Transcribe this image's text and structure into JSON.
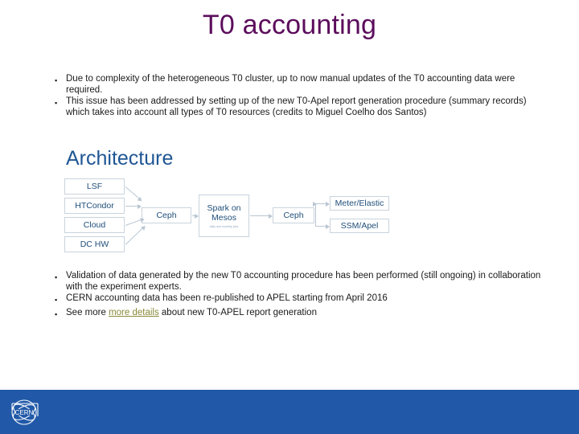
{
  "slide": {
    "title": "T0 accounting",
    "title_color": "#5c0d5c",
    "background": "#ffffff",
    "bullet_marker": "▪"
  },
  "bullets_top": [
    "Due to complexity of the heterogeneous T0 cluster, up to now manual updates of the T0 accounting data were required.",
    "This issue has been addressed by setting up of the new T0-Apel report generation procedure (summary records) which takes into account all types of T0 resources (credits to Miguel Coelho dos Santos)"
  ],
  "architecture": {
    "heading": "Architecture",
    "heading_color": "#1f5694",
    "nodes": {
      "lsf": "LSF",
      "htcondor": "HTCondor",
      "cloud": "Cloud",
      "dc_hw": "DC HW",
      "ceph_1": "Ceph",
      "spark_line1": "Spark on",
      "spark_line2": "Mesos",
      "spark_sub": "daily and monthly jobs",
      "ceph_2": "Ceph",
      "meter_elastic": "Meter/Elastic",
      "ssm_apel": "SSM/Apel"
    }
  },
  "bullets_bottom": [
    {
      "before": "Validation of data generated by the new T0 accounting procedure has been performed (still ongoing) in collaboration with the experiment experts.",
      "link": "",
      "after": ""
    },
    {
      "before": "CERN accounting data has been re-published to APEL starting from April 2016",
      "link": "",
      "after": ""
    },
    {
      "before": "See more ",
      "link": "more details",
      "after": " about new T0-APEL report generation"
    }
  ],
  "footer": {
    "bar_color": "#2159a8",
    "logo_label": "CERN"
  }
}
